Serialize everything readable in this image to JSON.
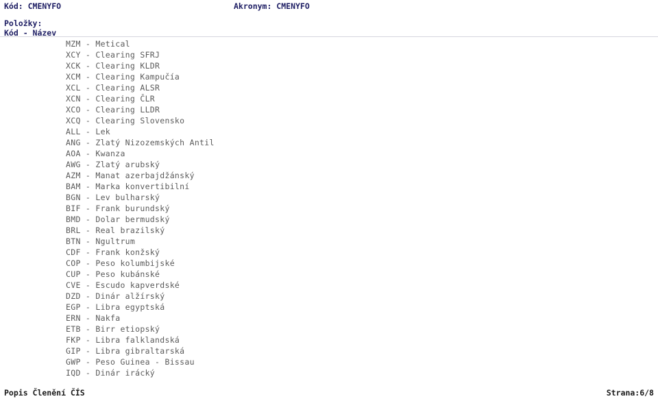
{
  "header": {
    "code_label": "Kód:",
    "code_value": "CMENYFO",
    "code_line": "Kód: CMENYFO",
    "acronym_label": "Akronym:",
    "acronym_value": "CMENYFO",
    "acronym_line": "Akronym: CMENYFO",
    "section_label": "Položky:",
    "columns_label": "Kód - Název",
    "text_color": "#1d1d63"
  },
  "items": [
    {
      "code": "MZM",
      "name": "Metical",
      "line": "MZM - Metical"
    },
    {
      "code": "XCY",
      "name": "Clearing SFRJ",
      "line": "XCY - Clearing SFRJ"
    },
    {
      "code": "XCK",
      "name": "Clearing KLDR",
      "line": "XCK - Clearing KLDR"
    },
    {
      "code": "XCM",
      "name": "Clearing Kampučía",
      "line": "XCM - Clearing Kampučía"
    },
    {
      "code": "XCL",
      "name": "Clearing ALSR",
      "line": "XCL - Clearing ALSR"
    },
    {
      "code": "XCN",
      "name": "Clearing ČLR",
      "line": "XCN - Clearing ČLR"
    },
    {
      "code": "XCO",
      "name": "Clearing LLDR",
      "line": "XCO - Clearing LLDR"
    },
    {
      "code": "XCQ",
      "name": "Clearing Slovensko",
      "line": "XCQ - Clearing Slovensko"
    },
    {
      "code": "ALL",
      "name": "Lek",
      "line": "ALL - Lek"
    },
    {
      "code": "ANG",
      "name": "Zlatý Nizozemských Antil",
      "line": "ANG - Zlatý Nizozemských Antil"
    },
    {
      "code": "AOA",
      "name": "Kwanza",
      "line": "AOA - Kwanza"
    },
    {
      "code": "AWG",
      "name": "Zlatý arubský",
      "line": "AWG - Zlatý arubský"
    },
    {
      "code": "AZM",
      "name": "Manat azerbajdžánský",
      "line": "AZM - Manat azerbajdžánský"
    },
    {
      "code": "BAM",
      "name": "Marka konvertibilní",
      "line": "BAM - Marka konvertibilní"
    },
    {
      "code": "BGN",
      "name": "Lev bulharský",
      "line": "BGN - Lev bulharský"
    },
    {
      "code": "BIF",
      "name": "Frank burundský",
      "line": "BIF - Frank burundský"
    },
    {
      "code": "BMD",
      "name": "Dolar bermudský",
      "line": "BMD - Dolar bermudský"
    },
    {
      "code": "BRL",
      "name": "Real brazilský",
      "line": "BRL - Real brazilský"
    },
    {
      "code": "BTN",
      "name": "Ngultrum",
      "line": "BTN - Ngultrum"
    },
    {
      "code": "CDF",
      "name": "Frank konžský",
      "line": "CDF - Frank konžský"
    },
    {
      "code": "COP",
      "name": "Peso kolumbijské",
      "line": "COP - Peso kolumbijské"
    },
    {
      "code": "CUP",
      "name": "Peso kubánské",
      "line": "CUP - Peso kubánské"
    },
    {
      "code": "CVE",
      "name": "Escudo kapverdské",
      "line": "CVE - Escudo kapverdské"
    },
    {
      "code": "DZD",
      "name": "Dinár alžírský",
      "line": "DZD - Dinár alžírský"
    },
    {
      "code": "EGP",
      "name": "Libra egyptská",
      "line": "EGP - Libra egyptská"
    },
    {
      "code": "ERN",
      "name": "Nakfa",
      "line": "ERN - Nakfa"
    },
    {
      "code": "ETB",
      "name": "Birr etiopský",
      "line": "ETB - Birr etiopský"
    },
    {
      "code": "FKP",
      "name": "Libra falklandská",
      "line": "FKP - Libra falklandská"
    },
    {
      "code": "GIP",
      "name": "Libra gibraltarská",
      "line": "GIP - Libra gibraltarská"
    },
    {
      "code": "GWP",
      "name": "Peso Guinea - Bissau",
      "line": "GWP - Peso Guinea - Bissau"
    },
    {
      "code": "IQD",
      "name": "Dinár irácký",
      "line": "IQD - Dinár irácký"
    }
  ],
  "footer": {
    "left_text": "Popis Členění ČÍS",
    "right_text": "Strana:6/8",
    "page_current": "6",
    "page_total": "8"
  }
}
